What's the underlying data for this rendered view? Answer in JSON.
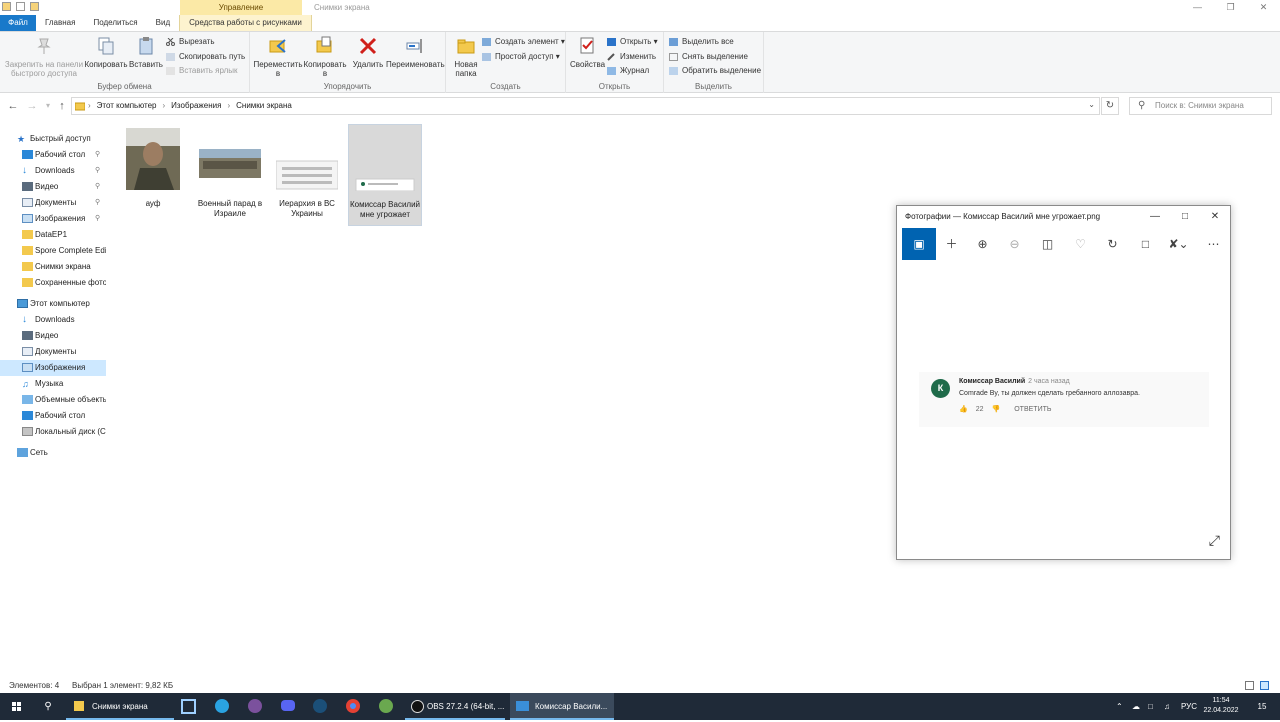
{
  "window": {
    "title": "Снимки экрана",
    "context_tab_group": "Управление"
  },
  "ribbon_tabs": [
    "Файл",
    "Главная",
    "Поделиться",
    "Вид",
    "Средства работы с рисунками"
  ],
  "ribbon": {
    "clipboard": {
      "group": "Буфер обмена",
      "pin": "Закрепить на панели быстрого доступа",
      "copy": "Копировать",
      "paste": "Вставить",
      "cut": "Вырезать",
      "copy_path": "Скопировать путь",
      "paste_shortcut": "Вставить ярлык"
    },
    "organize": {
      "group": "Упорядочить",
      "move_to": "Переместить в",
      "copy_to": "Копировать в",
      "delete": "Удалить",
      "rename": "Переименовать"
    },
    "new": {
      "group": "Создать",
      "new_folder": "Новая папка",
      "new_item": "Создать элемент",
      "easy_access": "Простой доступ"
    },
    "open": {
      "group": "Открыть",
      "properties": "Свойства",
      "open": "Открыть",
      "edit": "Изменить",
      "history": "Журнал"
    },
    "select": {
      "group": "Выделить",
      "select_all": "Выделить все",
      "select_none": "Снять выделение",
      "invert": "Обратить выделение"
    }
  },
  "address": {
    "crumbs": [
      "Этот компьютер",
      "Изображения",
      "Снимки экрана"
    ],
    "search_placeholder": "Поиск в: Снимки экрана"
  },
  "nav": {
    "quick_access": "Быстрый доступ",
    "quick_items": [
      "Рабочий стол",
      "Downloads",
      "Видео",
      "Документы",
      "Изображения",
      "DataEP1",
      "Spore Complete Edi",
      "Снимки экрана",
      "Сохраненные фото"
    ],
    "this_pc": "Этот компьютер",
    "pc_items": [
      "Downloads",
      "Видео",
      "Документы",
      "Изображения",
      "Музыка",
      "Объемные объекты",
      "Рабочий стол",
      "Локальный диск (C"
    ],
    "network": "Сеть"
  },
  "files": [
    {
      "name": "ауф"
    },
    {
      "name": "Военный парад в Израиле"
    },
    {
      "name": "Иерархия в ВС Украины"
    },
    {
      "name": "Комиссар Василий мне угрожает"
    }
  ],
  "status": {
    "count": "Элементов: 4",
    "selection": "Выбран 1 элемент: 9,82 КБ"
  },
  "photos": {
    "title": "Фотографии — Комиссар Василий мне угрожает.png",
    "comment": {
      "avatar_letter": "К",
      "author": "Комиссар Василий",
      "time": "2 часа назад",
      "text": "Comrade By, ты должен сделать гребанного аллозавра.",
      "likes": "22",
      "reply": "ОТВЕТИТЬ"
    }
  },
  "taskbar": {
    "explorer": "Снимки экрана",
    "obs": "OBS 27.2.4 (64-bit, ...",
    "photos": "Комиссар Васили...",
    "lang": "РУС",
    "time": "11:54",
    "date": "22.04.2022",
    "notifications": "15"
  }
}
